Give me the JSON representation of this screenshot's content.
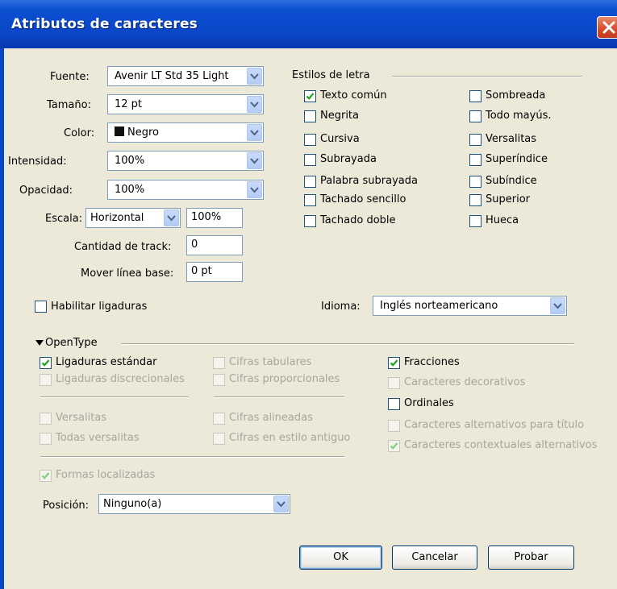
{
  "window": {
    "title": "Atributos de caracteres"
  },
  "fields": {
    "font_label": "Fuente:",
    "font_value": "Avenir LT Std 35 Light",
    "size_label": "Tamaño:",
    "size_value": "12 pt",
    "color_label": "Color:",
    "color_value": "Negro",
    "color_swatch": "#111111",
    "intensity_label": "Intensidad:",
    "intensity_value": "100%",
    "opacity_label": "Opacidad:",
    "opacity_value": "100%",
    "scale_label": "Escala:",
    "scale_mode": "Horizontal",
    "scale_value": "100%",
    "track_label": "Cantidad de track:",
    "track_value": "0",
    "baseline_label": "Mover línea base:",
    "baseline_value": "0 pt"
  },
  "styles": {
    "heading": "Estilos de letra",
    "items": [
      {
        "label": "Texto común",
        "checked": true
      },
      {
        "label": "Negrita",
        "checked": false
      },
      {
        "label": "Cursiva",
        "checked": false
      },
      {
        "label": "Subrayada",
        "checked": false
      },
      {
        "label": "Palabra subrayada",
        "checked": false
      },
      {
        "label": "Tachado sencillo",
        "checked": false
      },
      {
        "label": "Tachado doble",
        "checked": false
      },
      {
        "label": "Sombreada",
        "checked": false
      },
      {
        "label": "Todo mayús.",
        "checked": false
      },
      {
        "label": "Versalitas",
        "checked": false
      },
      {
        "label": "Superíndice",
        "checked": false
      },
      {
        "label": "Subíndice",
        "checked": false
      },
      {
        "label": "Superior",
        "checked": false
      },
      {
        "label": "Hueca",
        "checked": false
      }
    ]
  },
  "ligatures": {
    "label": "Habilitar ligaduras",
    "checked": false
  },
  "language": {
    "label": "Idioma:",
    "value": "Inglés norteamericano"
  },
  "opentype": {
    "heading": "OpenType",
    "items": [
      {
        "label": "Ligaduras estándar",
        "checked": true,
        "enabled": true
      },
      {
        "label": "Ligaduras discrecionales",
        "checked": false,
        "enabled": false
      },
      {
        "label": "Versalitas",
        "checked": false,
        "enabled": false
      },
      {
        "label": "Todas versalitas",
        "checked": false,
        "enabled": false
      },
      {
        "label": "Cifras tabulares",
        "checked": false,
        "enabled": false
      },
      {
        "label": "Cifras proporcionales",
        "checked": false,
        "enabled": false
      },
      {
        "label": "Cifras alineadas",
        "checked": false,
        "enabled": false
      },
      {
        "label": "Cifras en estilo antiguo",
        "checked": false,
        "enabled": false
      },
      {
        "label": "Fracciones",
        "checked": true,
        "enabled": true
      },
      {
        "label": "Caracteres decorativos",
        "checked": false,
        "enabled": false
      },
      {
        "label": "Ordinales",
        "checked": false,
        "enabled": true
      },
      {
        "label": "Caracteres alternativos para título",
        "checked": false,
        "enabled": false
      },
      {
        "label": "Caracteres contextuales alternativos",
        "checked": true,
        "enabled": false
      },
      {
        "label": "Formas localizadas",
        "checked": true,
        "enabled": false
      }
    ],
    "position_label": "Posición:",
    "position_value": "Ninguno(a)"
  },
  "buttons": {
    "ok": "OK",
    "cancel": "Cancelar",
    "preview": "Probar"
  },
  "icons": {
    "close": "close-icon",
    "dropdown": "chevron-down-icon",
    "disclosure": "triangle-down-icon",
    "check": "check-icon"
  }
}
